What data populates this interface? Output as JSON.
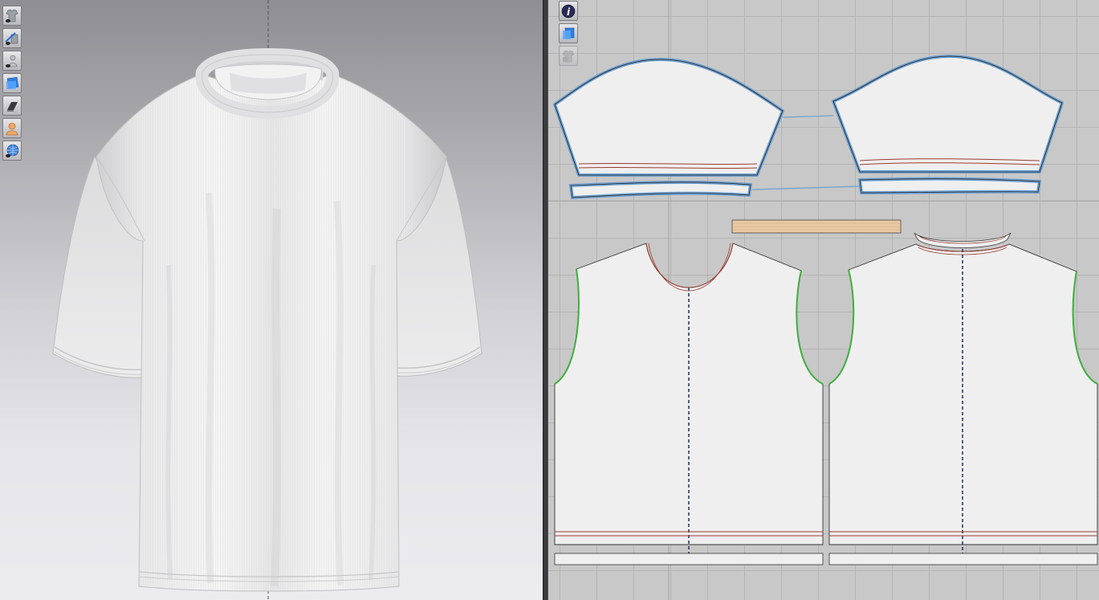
{
  "app": {
    "panels": {
      "left": "3d-avatar-view",
      "right": "2d-pattern-view"
    }
  },
  "toolbar3d": {
    "tools": [
      {
        "icon": "garment-visibility-icon"
      },
      {
        "icon": "sewing-line-visibility-icon"
      },
      {
        "icon": "avatar-visibility-icon"
      },
      {
        "icon": "texture-display-icon"
      },
      {
        "icon": "render-mode-icon"
      },
      {
        "icon": "avatar-skin-icon"
      },
      {
        "icon": "mesh-display-icon"
      }
    ]
  },
  "toolbar2d": {
    "tools": [
      {
        "icon": "info-icon"
      },
      {
        "icon": "pattern-texture-icon"
      },
      {
        "icon": "lock-garment-icon",
        "disabled": true
      }
    ]
  },
  "colors": {
    "seam_blue": "#6e9fd0",
    "armhole_green": "#3fae3f",
    "stitch_red": "#9b3b32",
    "collar_rib": "#e8c9a4",
    "pattern_fill": "#efefef",
    "centerline": "#1c2f5a"
  }
}
